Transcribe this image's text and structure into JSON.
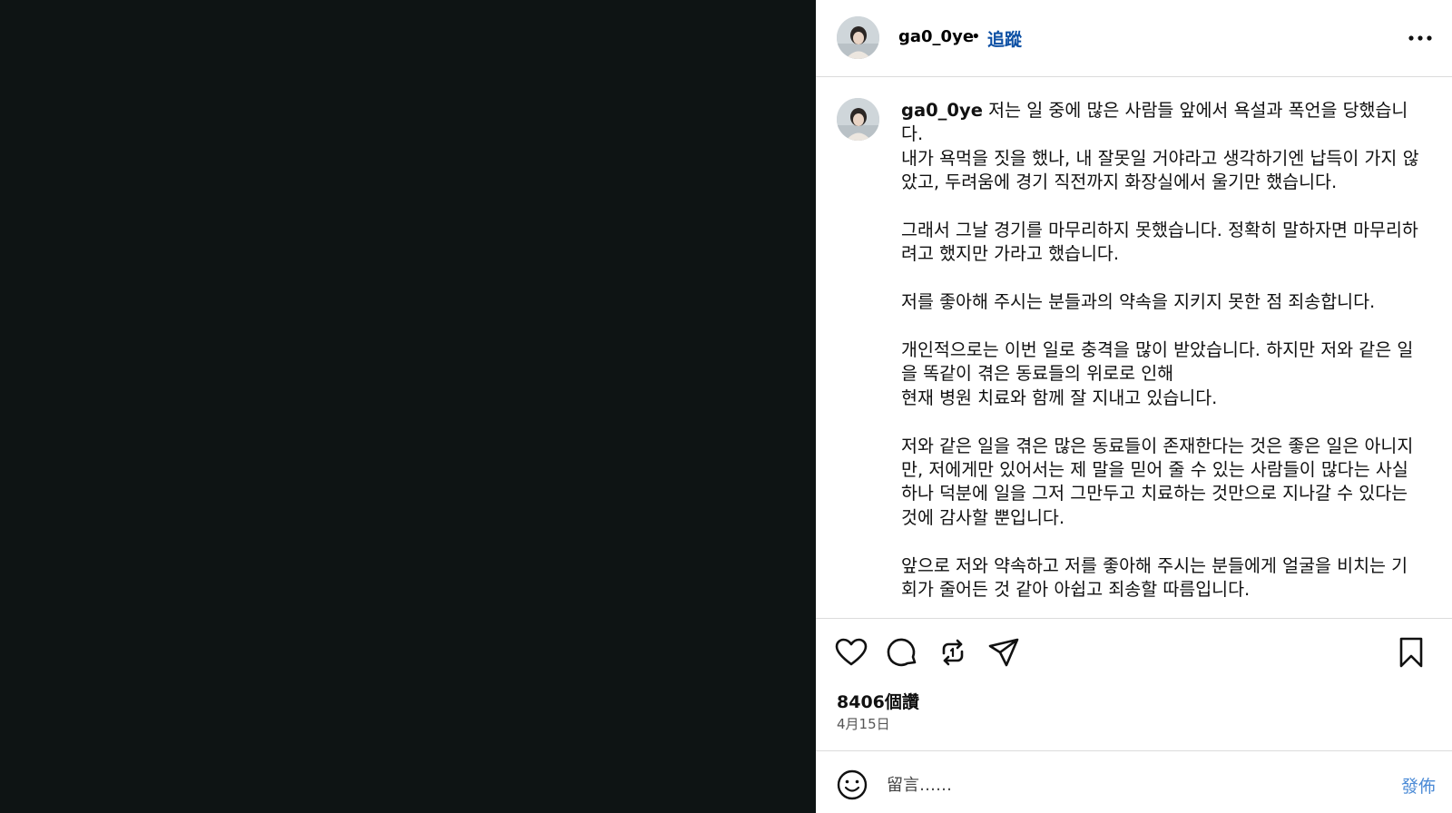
{
  "header": {
    "username": "ga0_0ye",
    "dot": "•",
    "follow_label": "追蹤"
  },
  "caption": {
    "username": "ga0_0ye",
    "paragraphs": [
      "저는 일 중에 많은 사람들 앞에서 욕설과 폭언을 당했습니다.\n내가 욕먹을 짓을 했나, 내 잘못일 거야라고 생각하기엔 납득이 가지 않았고, 두려움에 경기 직전까지 화장실에서 울기만 했습니다.",
      "그래서 그날 경기를 마무리하지 못했습니다. 정확히 말하자면 마무리하려고 했지만 가라고 했습니다.",
      "저를 좋아해 주시는 분들과의 약속을 지키지 못한 점 죄송합니다.",
      "개인적으로는 이번 일로 충격을 많이 받았습니다. 하지만 저와 같은 일을 똑같이 겪은 동료들의 위로로 인해\n현재 병원 치료와 함께 잘 지내고 있습니다.",
      "저와 같은 일을 겪은 많은 동료들이 존재한다는 것은 좋은 일은 아니지만, 저에게만 있어서는 제 말을 믿어 줄 수 있는 사람들이 많다는 사실 하나 덕분에 일을 그저 그만두고 치료하는 것만으로 지나갈 수 있다는 것에 감사할 뿐입니다.",
      "앞으로 저와 약속하고 저를 좋아해 주시는 분들에게 얼굴을 비치는 기회가 줄어든 것 같아 아쉽고 죄송할 따름입니다."
    ]
  },
  "stats": {
    "likes": "8406個讚",
    "date": "4月15日"
  },
  "comment": {
    "placeholder": "留言……",
    "post_label": "發佈"
  },
  "icons": {
    "more": "more-icon",
    "like": "heart-icon",
    "comment": "comment-icon",
    "repost": "repost-icon",
    "share": "share-icon",
    "save": "bookmark-icon",
    "emoji": "emoji-icon"
  },
  "colors": {
    "media_background": "#0e1414",
    "follow": "#0a4ea3",
    "post_button": "#4a8ad6",
    "divider": "#dbdbdb"
  }
}
